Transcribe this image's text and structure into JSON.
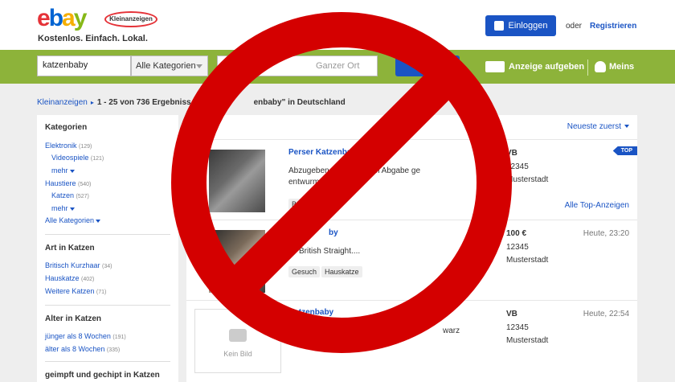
{
  "header": {
    "logo_letters": [
      "e",
      "b",
      "a",
      "y"
    ],
    "logo_badge": "Kleinanzeigen",
    "tagline": "Kostenlos. Einfach. Lokal.",
    "login_label": "Einloggen",
    "or_label": "oder",
    "register_label": "Registrieren"
  },
  "search": {
    "query": "katzenbaby",
    "category": "Alle Kategorien",
    "location_placeholder": "Ganzer Ort",
    "post_ad_label": "Anzeige aufgeben",
    "meins_label": "Meins"
  },
  "breadcrumb": {
    "root": "Kleinanzeigen",
    "sep": "▸",
    "results_before": "1 - 25 von 736 Ergebniss",
    "results_after": "enbaby\" in Deutschland"
  },
  "sidebar": {
    "categories_title": "Kategorien",
    "categories": [
      {
        "label": "Elektronik",
        "count": "(129)"
      },
      {
        "label": "Videospiele",
        "count": "(121)"
      },
      {
        "label": "mehr"
      },
      {
        "label": "Haustiere",
        "count": "(540)"
      },
      {
        "label": "Katzen",
        "count": "(527)"
      },
      {
        "label": "mehr"
      },
      {
        "label": "Alle Kategorien"
      }
    ],
    "art_title": "Art in Katzen",
    "art": [
      {
        "label": "Britisch Kurzhaar",
        "count": "(34)"
      },
      {
        "label": "Hauskatze",
        "count": "(402)"
      },
      {
        "label": "Weitere Katzen",
        "count": "(71)"
      }
    ],
    "alter_title": "Alter in Katzen",
    "alter": [
      {
        "label": "jünger als 8 Wochen",
        "count": "(191)"
      },
      {
        "label": "älter als 8 Wochen",
        "count": "(335)"
      }
    ],
    "geimpft_title": "geimpft und gechipt in Katzen"
  },
  "main": {
    "sort_label": "Neueste zuerst",
    "top_badge": "TOP",
    "all_top_label": "Alle Top-Anzeigen",
    "listings": [
      {
        "title": "Perser Katzenba",
        "desc_line1": "Abzugeben a                    Sie sind bei Abgabe ge",
        "desc_line2": "entwurm",
        "tag1": "Bri",
        "price": "VB",
        "zip": "12345",
        "city": "Musterstadt",
        "time": ""
      },
      {
        "title": "by",
        "desc": "British Straight....",
        "tag1": "Gesuch",
        "tag2": "Hauskatze",
        "price": "100 €",
        "zip": "12345",
        "city": "Musterstadt",
        "time": "Heute, 23:20"
      },
      {
        "title": "Katzenbaby",
        "desc": "warz",
        "no_image_label": "Kein Bild",
        "price": "VB",
        "zip": "12345",
        "city": "Musterstadt",
        "time": "Heute, 22:54"
      }
    ]
  },
  "colors": {
    "brand_green": "#8db33a",
    "brand_blue": "#1a54c4",
    "prohibit_red": "#d40000"
  }
}
